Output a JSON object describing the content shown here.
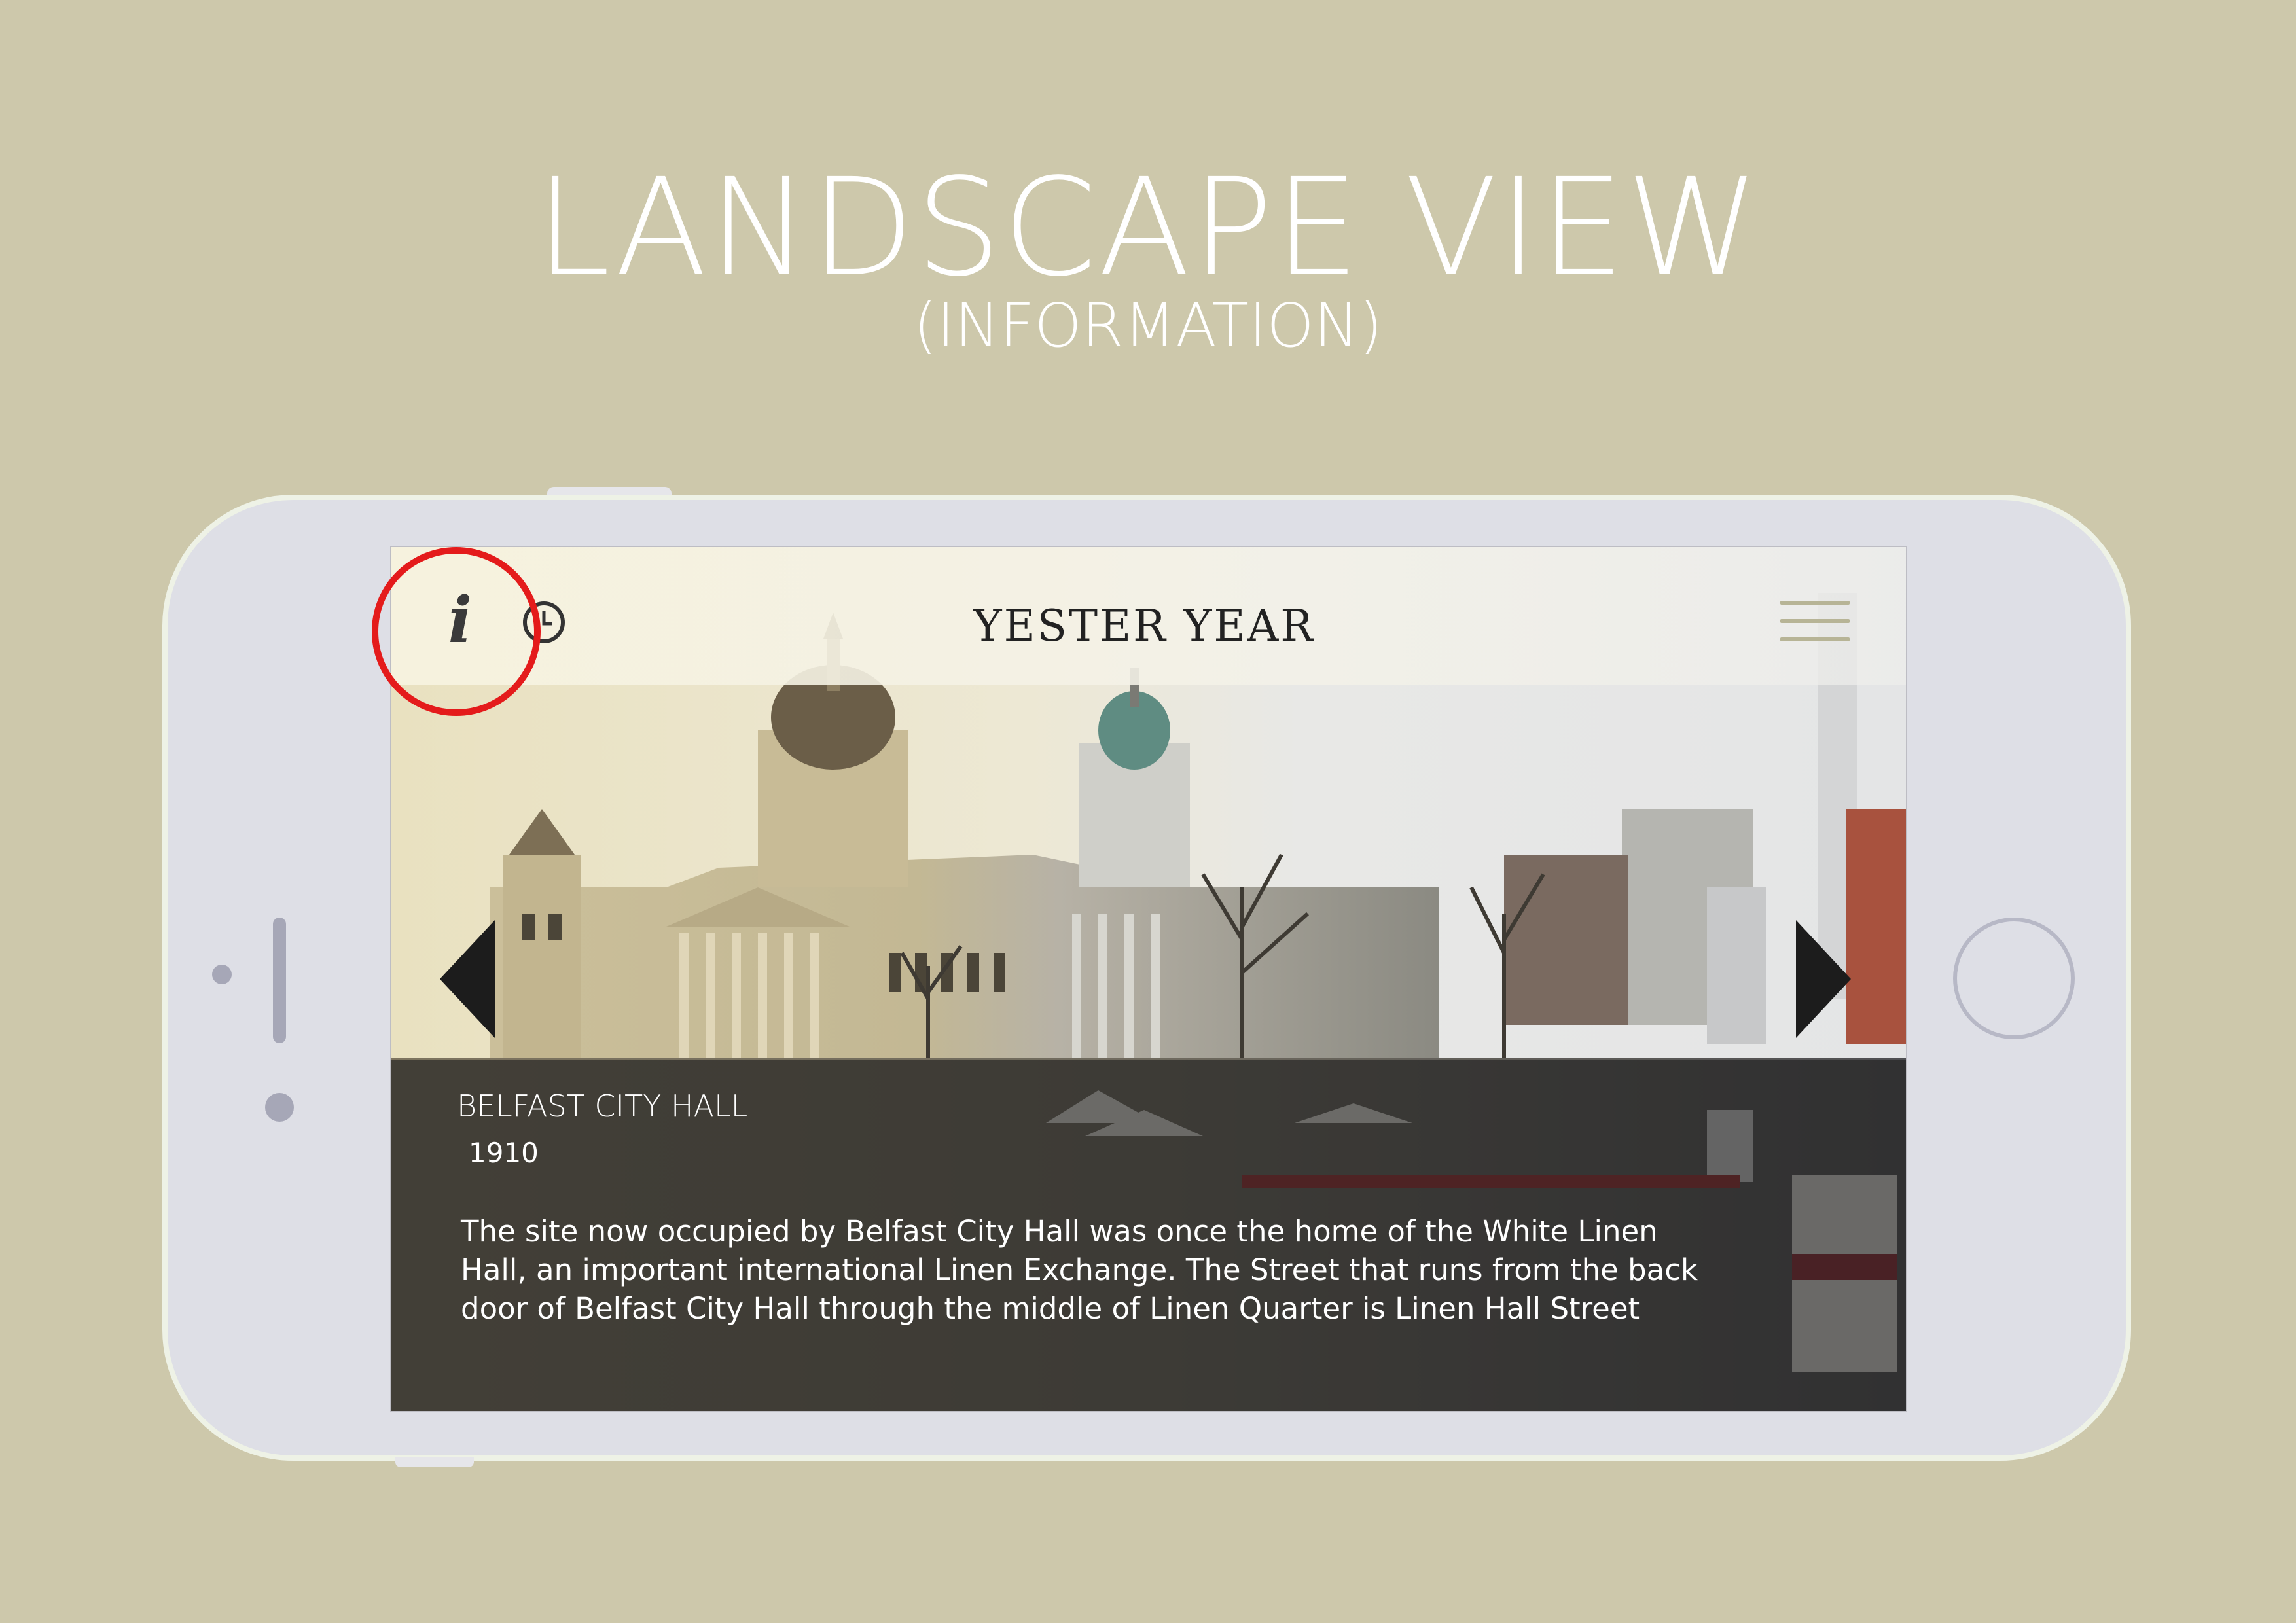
{
  "header": {
    "title": "LANDSCAPE VIEW",
    "subtitle": "(INFORMATION)"
  },
  "app": {
    "logo_text": "YESTER YEAR",
    "info_icon_glyph": "i",
    "icons": [
      "info-icon",
      "clock-icon",
      "hamburger-menu-icon",
      "chevron-left-icon",
      "chevron-right-icon"
    ]
  },
  "info": {
    "title": "BELFAST CITY HALL",
    "year": "1910",
    "description": "The site now occupied by Belfast City Hall was once the home of the White Linen Hall, an important international Linen Exchange. The Street that runs from the back door of Belfast City Hall through the middle of Linen Quarter is Linen Hall Street"
  },
  "colors": {
    "background": "#cdc8ab",
    "phone_body": "#dedfe6",
    "highlight": "#e41b1b",
    "menu_lines": "#b7b496",
    "panel_overlay": "rgba(30,30,30,0.62)"
  }
}
